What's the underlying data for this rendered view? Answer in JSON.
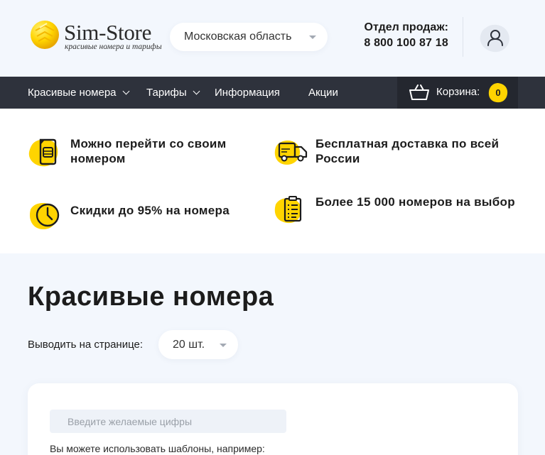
{
  "header": {
    "logo": {
      "brand": "Sim-Store",
      "tagline": "красивые номера и тарифы"
    },
    "region": {
      "selected": "Московская область"
    },
    "sales": {
      "label": "Отдел продаж:",
      "phone": "8 800 100 87 18"
    }
  },
  "nav": {
    "items": [
      {
        "label": "Красивые номера",
        "has_dropdown": true
      },
      {
        "label": "Тарифы",
        "has_dropdown": true
      },
      {
        "label": "Информация",
        "has_dropdown": false
      },
      {
        "label": "Акции",
        "has_dropdown": false
      }
    ],
    "cart": {
      "label": "Корзина:",
      "count": "0"
    }
  },
  "features": [
    {
      "icon": "sim-card-icon",
      "text": "Можно перейти со своим номером"
    },
    {
      "icon": "delivery-truck-icon",
      "text": "Бесплатная доставка по всей России"
    },
    {
      "icon": "clock-icon",
      "text": "Скидки до 95% на номера"
    },
    {
      "icon": "checklist-icon",
      "text": "Более 15 000 номеров на выбор"
    }
  ],
  "main": {
    "title": "Красивые номера",
    "per_page": {
      "label": "Выводить на странице:",
      "selected": "20 шт."
    },
    "search": {
      "placeholder": "Введите желаемые цифры",
      "hint": "Вы можете использовать шаблоны, например:"
    }
  },
  "colors": {
    "accent_yellow": "#ffd400",
    "nav_bg": "#2e323c",
    "cart_bg": "#24272f",
    "page_bg": "#f3f7fd"
  }
}
